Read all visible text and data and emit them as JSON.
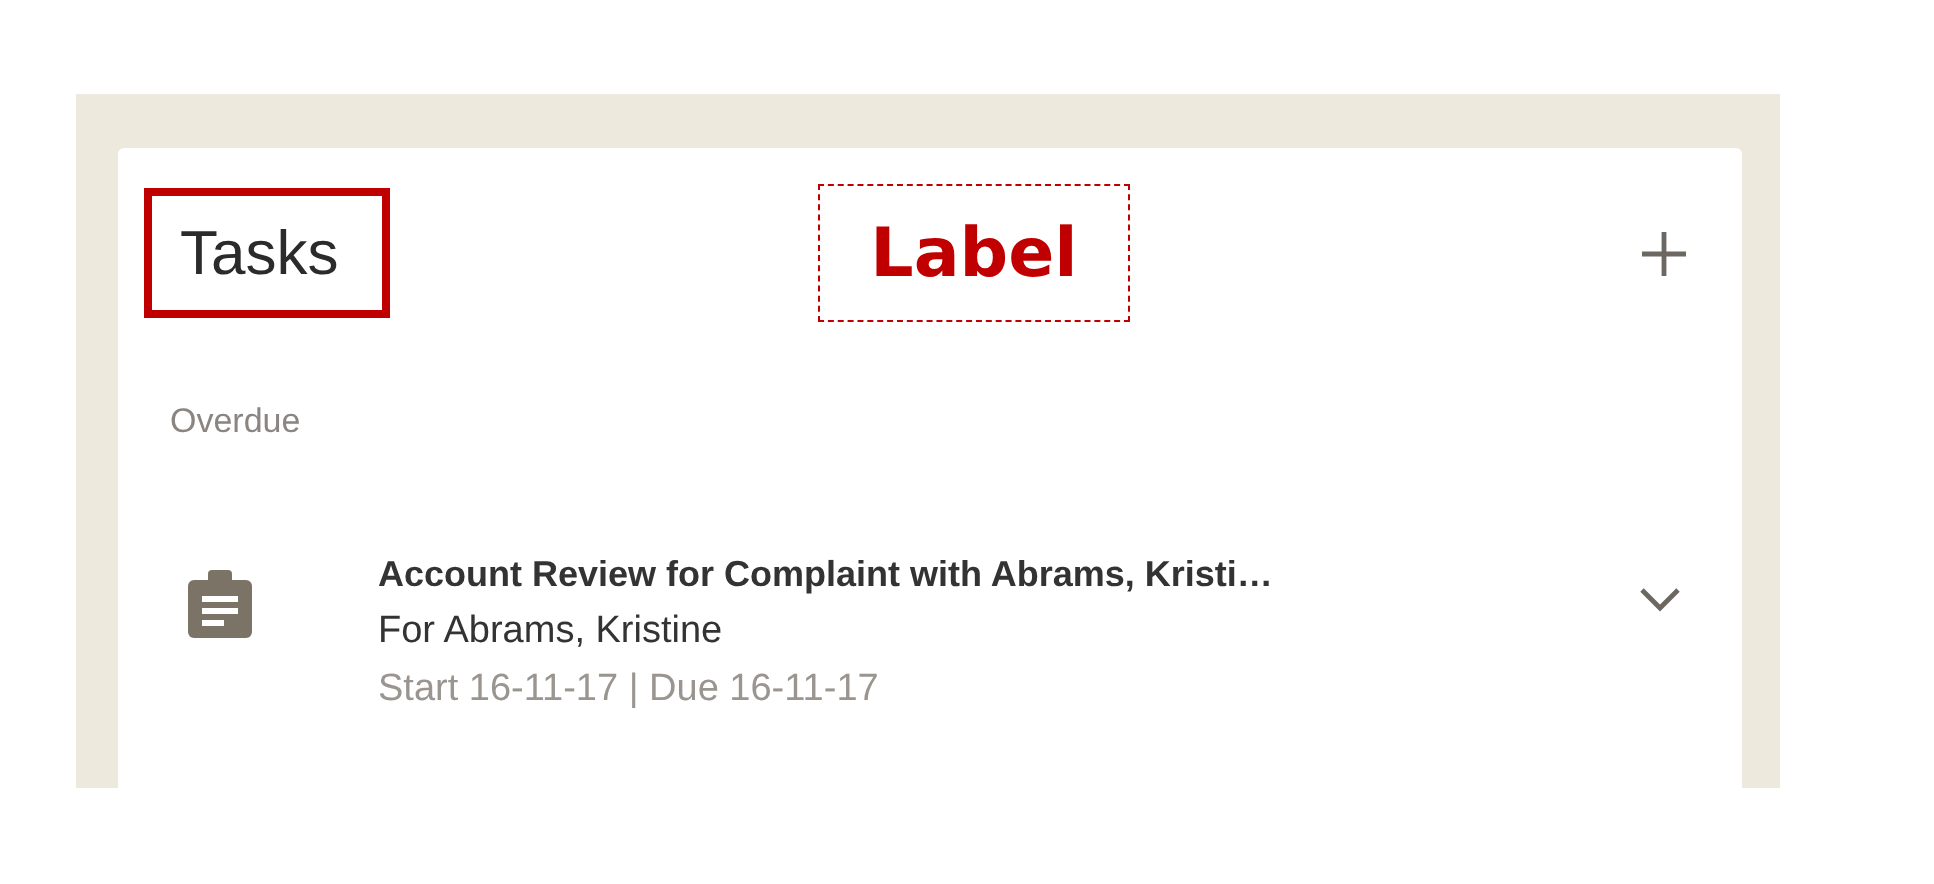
{
  "card": {
    "title": "Tasks",
    "annotation": "Label"
  },
  "section": {
    "heading": "Overdue"
  },
  "tasks": [
    {
      "title": "Account Review for Complaint with Abrams, Kristi…",
      "subtitle": "For Abrams, Kristine",
      "dates": "Start 16-11-17 | Due 16-11-17"
    }
  ]
}
